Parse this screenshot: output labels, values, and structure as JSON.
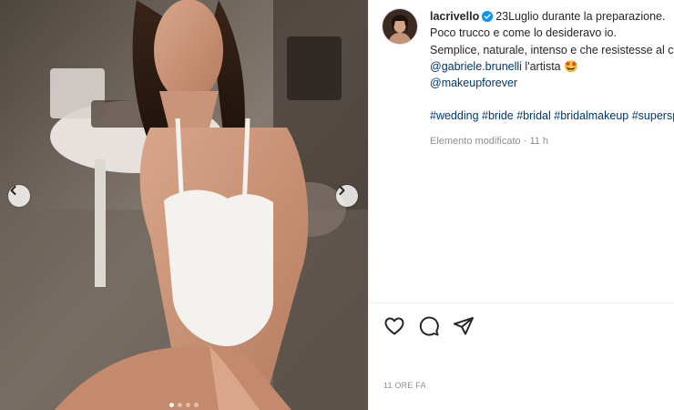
{
  "post": {
    "username": "lacrivello",
    "caption_line1": "23Luglio durante la preparazione.",
    "caption_line2": "Poco trucco e come lo desideravo io.",
    "caption_line3": "Semplice, naturale, intenso e che resistesse al caldo.",
    "mention1": "@gabriele.brunelli",
    "mention1_suffix": " l'artista ",
    "mention1_emoji": "🤩",
    "mention2": "@makeupforever",
    "hashtags": [
      "#wedding",
      "#bride",
      "#bridal",
      "#bridalmakeup",
      "#supersposa"
    ],
    "edited_label": "Elemento modificato",
    "edited_time": "11 h",
    "time_ago": "11 ORE FA"
  },
  "carousel": {
    "dot_count": 4,
    "active_index": 0
  },
  "icons": {
    "verified": "verified-badge-icon",
    "like": "heart-icon",
    "comment": "comment-icon",
    "share": "share-icon",
    "prev": "chevron-left-icon",
    "next": "chevron-right-icon"
  },
  "colors": {
    "link": "#00376b",
    "verified": "#0095f6",
    "muted": "#8e8e8e"
  }
}
